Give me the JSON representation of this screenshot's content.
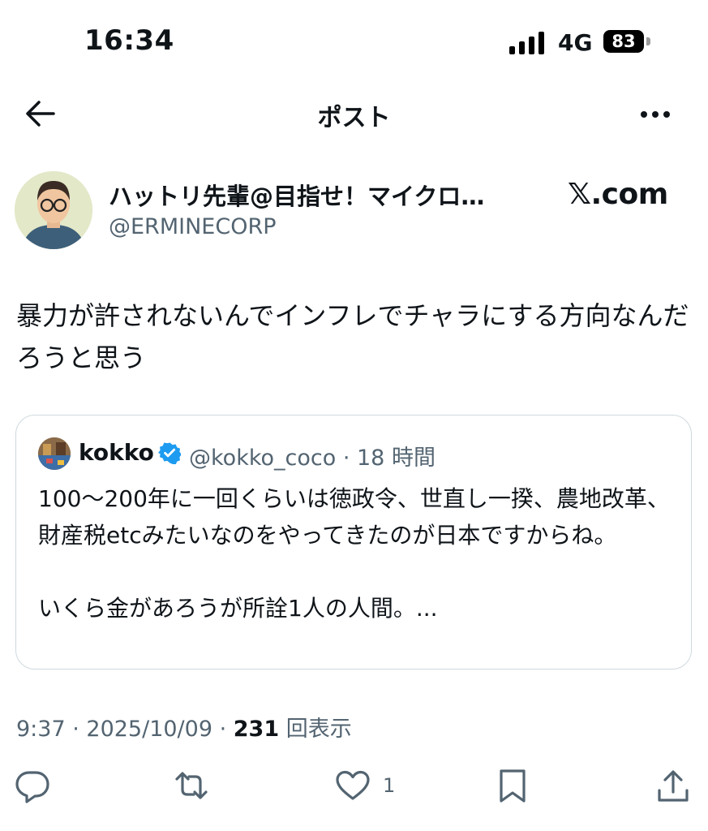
{
  "status_bar": {
    "time": "16:34",
    "network": "4G",
    "battery": "83"
  },
  "header": {
    "title": "ポスト",
    "back_icon": "arrow-left-icon",
    "more_icon": "more-horizontal-icon"
  },
  "post": {
    "author_name": "ハットリ先輩@目指せ！マイクロ…",
    "author_handle": "@ERMINECORP",
    "site_label": "𝕏.com",
    "text": "暴力が許されないんでインフレでチャラにする方向なんだろうと思う",
    "time": "9:37",
    "date": "2025/10/09",
    "views_count": "231",
    "views_label": "回表示",
    "like_count": "1"
  },
  "quote": {
    "name": "kokko",
    "handle": "@kokko_coco",
    "time": "18 時間",
    "text": "100〜200年に一回くらいは徳政令、世直し一揆、農地改革、財産税etcみたいなのをやってきたのが日本ですからね。\n\nいくら金があろうが所詮1人の人間。..."
  },
  "colors": {
    "text": "#0f1419",
    "secondary": "#536471",
    "verified": "#1d9bf0",
    "border": "#cfd9de"
  }
}
